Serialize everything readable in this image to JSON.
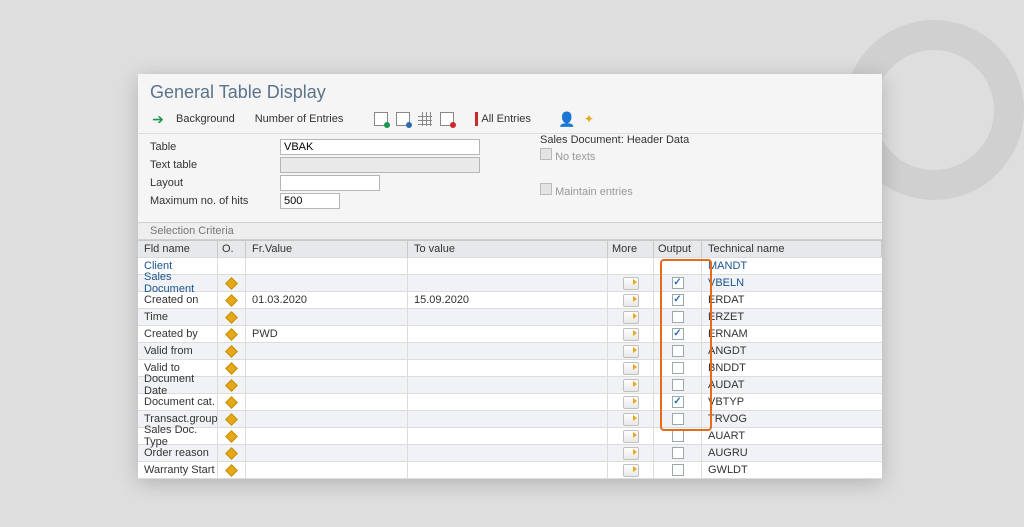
{
  "title": "General Table Display",
  "toolbar": {
    "background": "Background",
    "entries": "Number of Entries",
    "all_entries": "All Entries"
  },
  "form": {
    "table_label": "Table",
    "table_value": "VBAK",
    "text_table_label": "Text table",
    "text_table_value": "",
    "layout_label": "Layout",
    "layout_value": "",
    "hits_label": "Maximum no. of hits",
    "hits_value": "500",
    "header_desc": "Sales Document: Header Data",
    "no_texts": "No texts",
    "maintain": "Maintain entries"
  },
  "criteria_label": "Selection Criteria",
  "cols": {
    "fld": "Fld name",
    "o": "O.",
    "fr": "Fr.Value",
    "to": "To value",
    "more": "More",
    "out": "Output",
    "tech": "Technical name"
  },
  "rows": [
    {
      "fld": "Client",
      "fr": "",
      "to": "",
      "op": false,
      "more": false,
      "out": false,
      "out_cb": false,
      "tech": "MANDT",
      "link": true
    },
    {
      "fld": "Sales Document",
      "fr": "",
      "to": "",
      "op": true,
      "more": true,
      "out": true,
      "out_cb": true,
      "tech": "VBELN",
      "link": true
    },
    {
      "fld": "Created on",
      "fr": "01.03.2020",
      "to": "15.09.2020",
      "op": true,
      "more": true,
      "out": true,
      "out_cb": true,
      "tech": "ERDAT",
      "link": false
    },
    {
      "fld": "Time",
      "fr": "",
      "to": "",
      "op": true,
      "more": true,
      "out": false,
      "out_cb": true,
      "tech": "ERZET",
      "link": false
    },
    {
      "fld": "Created by",
      "fr": "PWD",
      "to": "",
      "op": true,
      "more": true,
      "out": true,
      "out_cb": true,
      "tech": "ERNAM",
      "link": false
    },
    {
      "fld": "Valid from",
      "fr": "",
      "to": "",
      "op": true,
      "more": true,
      "out": false,
      "out_cb": true,
      "tech": "ANGDT",
      "link": false
    },
    {
      "fld": "Valid to",
      "fr": "",
      "to": "",
      "op": true,
      "more": true,
      "out": false,
      "out_cb": true,
      "tech": "BNDDT",
      "link": false
    },
    {
      "fld": "Document Date",
      "fr": "",
      "to": "",
      "op": true,
      "more": true,
      "out": false,
      "out_cb": true,
      "tech": "AUDAT",
      "link": false
    },
    {
      "fld": "Document cat.",
      "fr": "",
      "to": "",
      "op": true,
      "more": true,
      "out": true,
      "out_cb": true,
      "tech": "VBTYP",
      "link": false
    },
    {
      "fld": "Transact.group",
      "fr": "",
      "to": "",
      "op": true,
      "more": true,
      "out": false,
      "out_cb": true,
      "tech": "TRVOG",
      "link": false
    },
    {
      "fld": "Sales Doc. Type",
      "fr": "",
      "to": "",
      "op": true,
      "more": true,
      "out": false,
      "out_cb": true,
      "tech": "AUART",
      "link": false
    },
    {
      "fld": "Order reason",
      "fr": "",
      "to": "",
      "op": true,
      "more": true,
      "out": false,
      "out_cb": true,
      "tech": "AUGRU",
      "link": false
    },
    {
      "fld": "Warranty Start",
      "fr": "",
      "to": "",
      "op": true,
      "more": true,
      "out": false,
      "out_cb": true,
      "tech": "GWLDT",
      "link": false
    }
  ]
}
